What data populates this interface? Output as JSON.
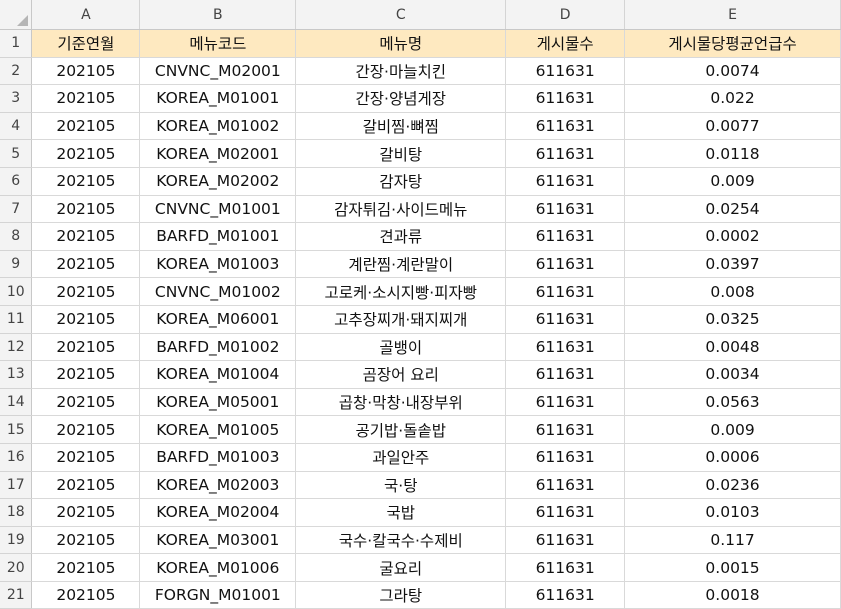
{
  "columns": [
    "A",
    "B",
    "C",
    "D",
    "E"
  ],
  "header_row": {
    "row_num": "1",
    "cells": [
      "기준연월",
      "메뉴코드",
      "메뉴명",
      "게시물수",
      "게시물당평균언급수"
    ]
  },
  "header_fill": "#fee9c0",
  "rows": [
    {
      "n": "2",
      "cells": [
        "202105",
        "CNVNC_M02001",
        "간장·마늘치킨",
        "611631",
        "0.0074"
      ]
    },
    {
      "n": "3",
      "cells": [
        "202105",
        "KOREA_M01001",
        "간장·양념게장",
        "611631",
        "0.022"
      ]
    },
    {
      "n": "4",
      "cells": [
        "202105",
        "KOREA_M01002",
        "갈비찜·뼈찜",
        "611631",
        "0.0077"
      ]
    },
    {
      "n": "5",
      "cells": [
        "202105",
        "KOREA_M02001",
        "갈비탕",
        "611631",
        "0.0118"
      ]
    },
    {
      "n": "6",
      "cells": [
        "202105",
        "KOREA_M02002",
        "감자탕",
        "611631",
        "0.009"
      ]
    },
    {
      "n": "7",
      "cells": [
        "202105",
        "CNVNC_M01001",
        "감자튀김·사이드메뉴",
        "611631",
        "0.0254"
      ]
    },
    {
      "n": "8",
      "cells": [
        "202105",
        "BARFD_M01001",
        "견과류",
        "611631",
        "0.0002"
      ]
    },
    {
      "n": "9",
      "cells": [
        "202105",
        "KOREA_M01003",
        "계란찜·계란말이",
        "611631",
        "0.0397"
      ]
    },
    {
      "n": "10",
      "cells": [
        "202105",
        "CNVNC_M01002",
        "고로케·소시지빵·피자빵",
        "611631",
        "0.008"
      ]
    },
    {
      "n": "11",
      "cells": [
        "202105",
        "KOREA_M06001",
        "고추장찌개·돼지찌개",
        "611631",
        "0.0325"
      ]
    },
    {
      "n": "12",
      "cells": [
        "202105",
        "BARFD_M01002",
        "골뱅이",
        "611631",
        "0.0048"
      ]
    },
    {
      "n": "13",
      "cells": [
        "202105",
        "KOREA_M01004",
        "곰장어 요리",
        "611631",
        "0.0034"
      ]
    },
    {
      "n": "14",
      "cells": [
        "202105",
        "KOREA_M05001",
        "곱창·막창·내장부위",
        "611631",
        "0.0563"
      ]
    },
    {
      "n": "15",
      "cells": [
        "202105",
        "KOREA_M01005",
        "공기밥·돌솥밥",
        "611631",
        "0.009"
      ]
    },
    {
      "n": "16",
      "cells": [
        "202105",
        "BARFD_M01003",
        "과일안주",
        "611631",
        "0.0006"
      ]
    },
    {
      "n": "17",
      "cells": [
        "202105",
        "KOREA_M02003",
        "국·탕",
        "611631",
        "0.0236"
      ]
    },
    {
      "n": "18",
      "cells": [
        "202105",
        "KOREA_M02004",
        "국밥",
        "611631",
        "0.0103"
      ]
    },
    {
      "n": "19",
      "cells": [
        "202105",
        "KOREA_M03001",
        "국수·칼국수·수제비",
        "611631",
        "0.117"
      ]
    },
    {
      "n": "20",
      "cells": [
        "202105",
        "KOREA_M01006",
        "굴요리",
        "611631",
        "0.0015"
      ]
    },
    {
      "n": "21",
      "cells": [
        "202105",
        "FORGN_M01001",
        "그라탕",
        "611631",
        "0.0018"
      ]
    }
  ]
}
